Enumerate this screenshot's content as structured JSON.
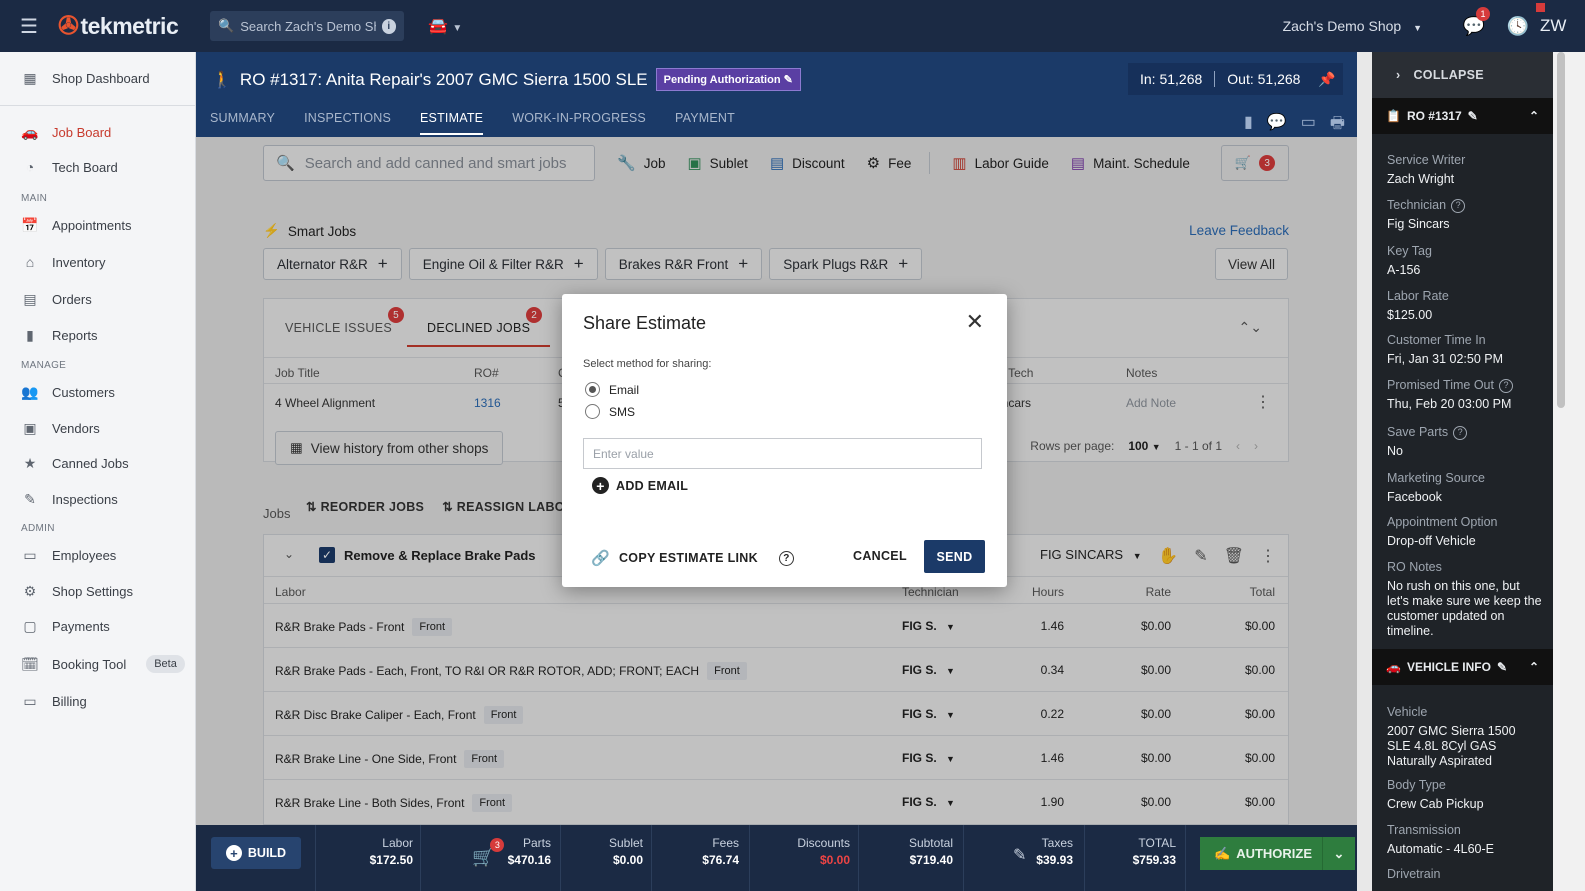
{
  "topbar": {
    "logo": "tekmetric",
    "search_placeholder": "Search Zach's Demo Shop",
    "shop_name": "Zach's Demo Shop",
    "messages_badge": "1",
    "user_initials": "ZW"
  },
  "sidebar": {
    "items": [
      {
        "label": "Shop Dashboard",
        "icon": "dashboard-icon"
      },
      {
        "label": "Job Board",
        "icon": "car-icon"
      },
      {
        "label": "Tech Board",
        "icon": "speedometer-icon"
      },
      {
        "label": "Appointments",
        "icon": "calendar-icon"
      },
      {
        "label": "Inventory",
        "icon": "warehouse-icon"
      },
      {
        "label": "Orders",
        "icon": "list-icon"
      },
      {
        "label": "Reports",
        "icon": "bar-chart-icon"
      },
      {
        "label": "Customers",
        "icon": "people-icon"
      },
      {
        "label": "Vendors",
        "icon": "store-icon"
      },
      {
        "label": "Canned Jobs",
        "icon": "star-icon"
      },
      {
        "label": "Inspections",
        "icon": "clipboard-icon"
      },
      {
        "label": "Employees",
        "icon": "badge-icon"
      },
      {
        "label": "Shop Settings",
        "icon": "gear-icon"
      },
      {
        "label": "Payments",
        "icon": "payments-icon"
      },
      {
        "label": "Booking Tool",
        "icon": "booking-icon"
      },
      {
        "label": "Billing",
        "icon": "credit-card-icon"
      }
    ],
    "sections": {
      "main": "MAIN",
      "manage": "MANAGE",
      "admin": "ADMIN"
    },
    "beta_label": "Beta"
  },
  "ro": {
    "title": "RO #1317: Anita Repair's 2007 GMC Sierra 1500 SLE",
    "status": "Pending Authorization",
    "mileage_in": "In: 51,268",
    "mileage_out": "Out: 51,268",
    "tabs": [
      "SUMMARY",
      "INSPECTIONS",
      "ESTIMATE",
      "WORK-IN-PROGRESS",
      "PAYMENT"
    ],
    "active_tab": "ESTIMATE"
  },
  "toolbar": {
    "search_placeholder": "Search and add canned and smart jobs",
    "buttons": [
      "Job",
      "Sublet",
      "Discount",
      "Fee",
      "Labor Guide",
      "Maint. Schedule"
    ],
    "cart_count": "3"
  },
  "smart_jobs": {
    "label": "Smart Jobs",
    "feedback": "Leave Feedback",
    "chips": [
      "Alternator R&R",
      "Engine Oil & Filter R&R",
      "Brakes R&R Front",
      "Spark Plugs R&R"
    ],
    "view_all": "View All"
  },
  "issues_panel": {
    "tabs": [
      {
        "label": "VEHICLE ISSUES",
        "badge": "5"
      },
      {
        "label": "DECLINED JOBS",
        "badge": "2"
      }
    ],
    "columns": {
      "job_title": "Job Title",
      "ro": "RO#",
      "c3": "C",
      "tech": "lt Tech",
      "notes": "Notes"
    },
    "row": {
      "job_title": "4 Wheel Alignment",
      "ro": "1316",
      "c3": "5",
      "tech": "incars",
      "notes": "Add Note"
    },
    "history_button": "View history from other shops",
    "rows_per_page_label": "Rows per page:",
    "rows_per_page": "100",
    "range": "1 - 1 of 1"
  },
  "jobs": {
    "label": "Jobs",
    "reorder": "REORDER JOBS",
    "reassign": "REASSIGN LABO",
    "job": {
      "title": "Remove & Replace Brake Pads",
      "technician": "FIG SINCARS",
      "columns": {
        "labor": "Labor",
        "technician": "Technician",
        "hours": "Hours",
        "rate": "Rate",
        "total": "Total"
      },
      "lines": [
        {
          "desc": "R&R Brake Pads - Front",
          "tag": "Front",
          "tech": "FIG S.",
          "hours": "1.46",
          "rate": "$0.00",
          "total": "$0.00"
        },
        {
          "desc": "R&R Brake Pads - Each, Front, TO R&I OR R&R ROTOR, ADD; FRONT; EACH",
          "tag": "Front",
          "tech": "FIG S.",
          "hours": "0.34",
          "rate": "$0.00",
          "total": "$0.00"
        },
        {
          "desc": "R&R Disc Brake Caliper - Each, Front",
          "tag": "Front",
          "tech": "FIG S.",
          "hours": "0.22",
          "rate": "$0.00",
          "total": "$0.00"
        },
        {
          "desc": "R&R Brake Line - One Side, Front",
          "tag": "Front",
          "tech": "FIG S.",
          "hours": "1.46",
          "rate": "$0.00",
          "total": "$0.00"
        },
        {
          "desc": "R&R Brake Line - Both Sides, Front",
          "tag": "Front",
          "tech": "FIG S.",
          "hours": "1.90",
          "rate": "$0.00",
          "total": "$0.00"
        }
      ]
    }
  },
  "modal": {
    "title": "Share Estimate",
    "method_label": "Select method for sharing:",
    "options": [
      "Email",
      "SMS"
    ],
    "selected": "Email",
    "input_placeholder": "Enter value",
    "add_email": "ADD EMAIL",
    "copy_link": "COPY ESTIMATE LINK",
    "cancel": "CANCEL",
    "send": "SEND"
  },
  "footer": {
    "build": "BUILD",
    "parts_badge": "3",
    "totals": [
      {
        "label": "Labor",
        "value": "$172.50"
      },
      {
        "label": "Parts",
        "value": "$470.16"
      },
      {
        "label": "Sublet",
        "value": "$0.00"
      },
      {
        "label": "Fees",
        "value": "$76.74"
      },
      {
        "label": "Discounts",
        "value": "$0.00"
      },
      {
        "label": "Subtotal",
        "value": "$719.40"
      },
      {
        "label": "Taxes",
        "value": "$39.93"
      },
      {
        "label": "TOTAL",
        "value": "$759.33"
      }
    ],
    "authorize": "AUTHORIZE"
  },
  "right_panel": {
    "collapse": "COLLAPSE",
    "ro_section": "RO #1317",
    "fields": [
      {
        "label": "Service Writer",
        "value": "Zach Wright"
      },
      {
        "label": "Technician",
        "value": "Fig Sincars"
      },
      {
        "label": "Key Tag",
        "value": "A-156"
      },
      {
        "label": "Labor Rate",
        "value": "$125.00"
      },
      {
        "label": "Customer Time In",
        "value": "Fri, Jan 31 02:50 PM"
      },
      {
        "label": "Promised Time Out",
        "value": "Thu, Feb 20 03:00 PM"
      },
      {
        "label": "Save Parts",
        "value": "No"
      },
      {
        "label": "Marketing Source",
        "value": "Facebook"
      },
      {
        "label": "Appointment Option",
        "value": "Drop-off Vehicle"
      },
      {
        "label": "RO Notes",
        "value": "No rush on this one, but let's make sure we keep the customer updated on timeline."
      }
    ],
    "vehicle_section": "VEHICLE INFO",
    "vehicle_fields": [
      {
        "label": "Vehicle",
        "value": "2007 GMC Sierra 1500 SLE 4.8L 8Cyl GAS Naturally Aspirated"
      },
      {
        "label": "Body Type",
        "value": "Crew Cab Pickup"
      },
      {
        "label": "Transmission",
        "value": "Automatic - 4L60-E"
      },
      {
        "label": "Drivetrain",
        "value": ""
      }
    ]
  }
}
